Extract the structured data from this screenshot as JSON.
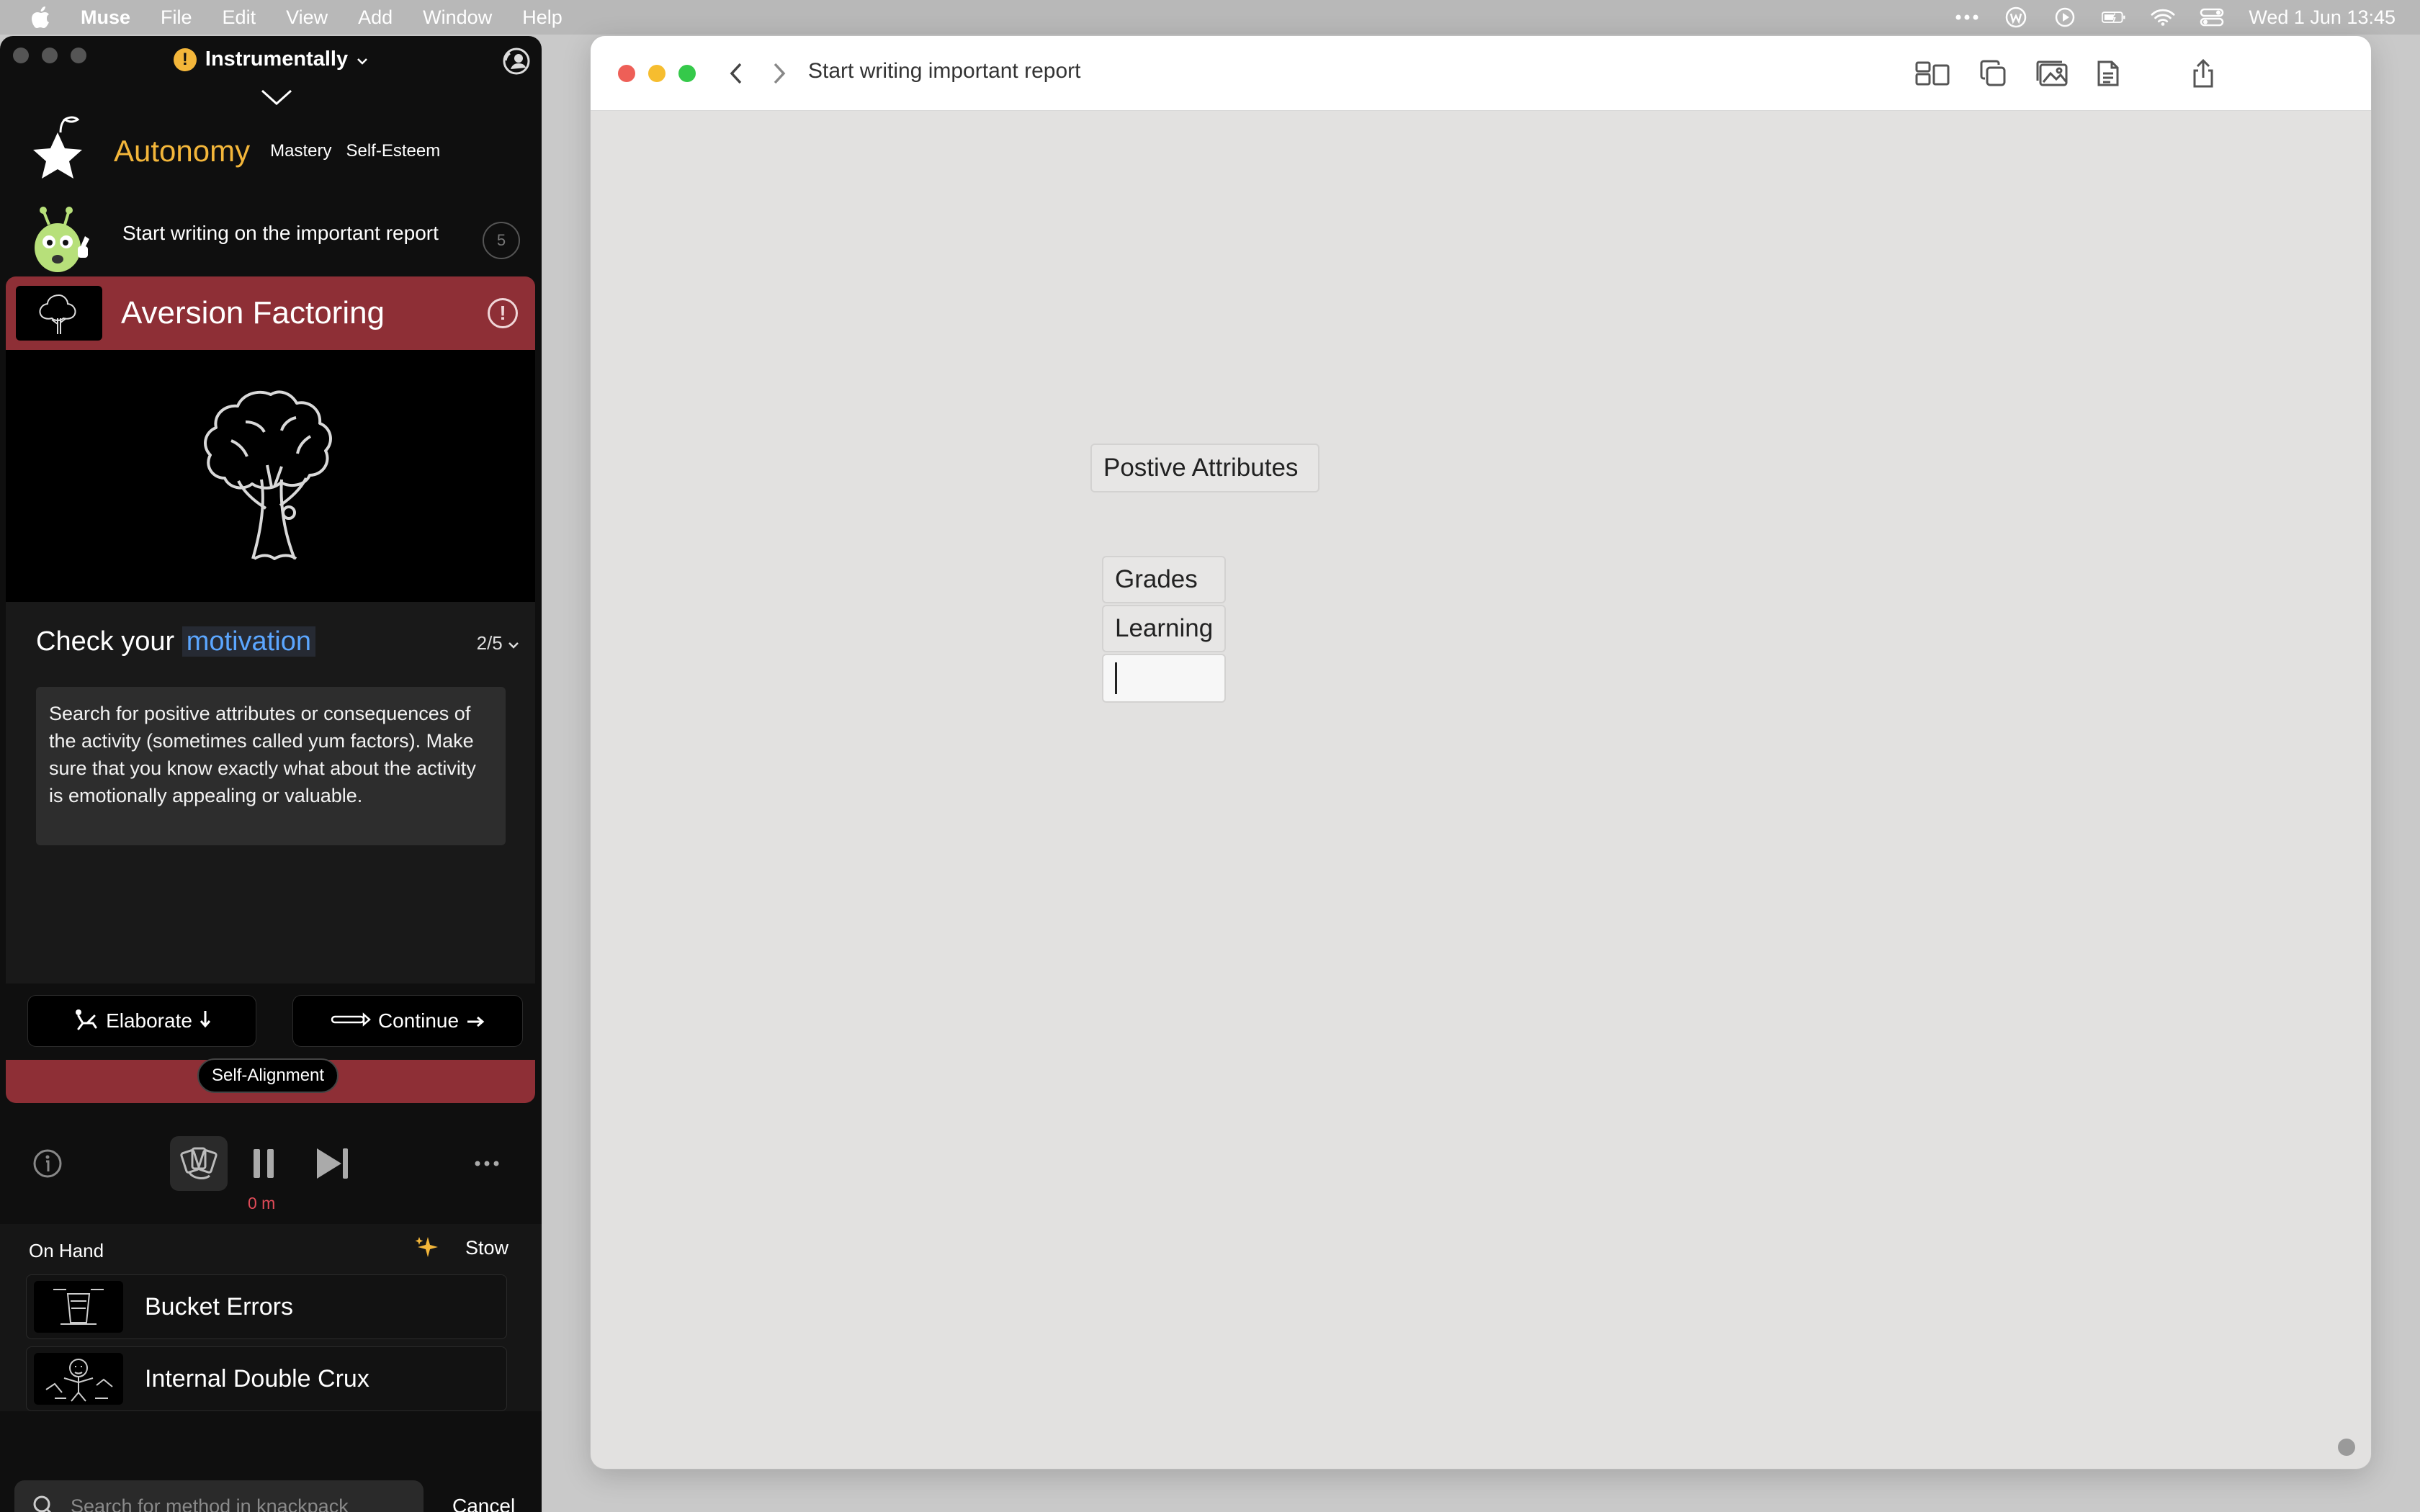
{
  "menubar": {
    "app_name": "Muse",
    "items": [
      "File",
      "Edit",
      "View",
      "Add",
      "Window",
      "Help"
    ],
    "clock": "Wed 1 Jun  13:45"
  },
  "left_panel": {
    "title": "Instrumentally",
    "warn_symbol": "!",
    "need": {
      "main": "Autonomy",
      "secondary": [
        "Mastery",
        "Self-Esteem"
      ]
    },
    "task": {
      "text": "Start writing on the important report",
      "counter": "5"
    },
    "card": {
      "title": "Aversion Factoring",
      "info_symbol": "!",
      "step_heading_prefix": "Check your",
      "step_heading_highlight": "motivation",
      "step_progress": "2/5",
      "description": "Search for positive attributes or consequences of the activity (sometimes called yum factors). Make sure that you know exactly what about the activity is emotionally appealing or valuable.",
      "elaborate_label": "Elaborate",
      "continue_label": "Continue",
      "footer_tag": "Self-Alignment"
    },
    "controls": {
      "elapsed": "0 m"
    },
    "on_hand": {
      "label": "On Hand",
      "stow_label": "Stow",
      "items": [
        {
          "name": "Bucket Errors"
        },
        {
          "name": "Internal Double Crux"
        }
      ]
    },
    "search": {
      "placeholder": "Search for method in knackpack",
      "cancel_label": "Cancel"
    }
  },
  "muse_window": {
    "title": "Start writing important report",
    "cards": {
      "heading": "Postive Attributes",
      "items": [
        "Grades",
        "Learning",
        ""
      ]
    }
  },
  "colors": {
    "accent_yellow": "#f3b63a",
    "card_red": "#8e2f36",
    "highlight_blue": "#5ba6ff",
    "timer_red": "#e04b58",
    "traffic_red": "#ee5f57",
    "traffic_yellow": "#f6bd2f",
    "traffic_green": "#35c94a"
  }
}
